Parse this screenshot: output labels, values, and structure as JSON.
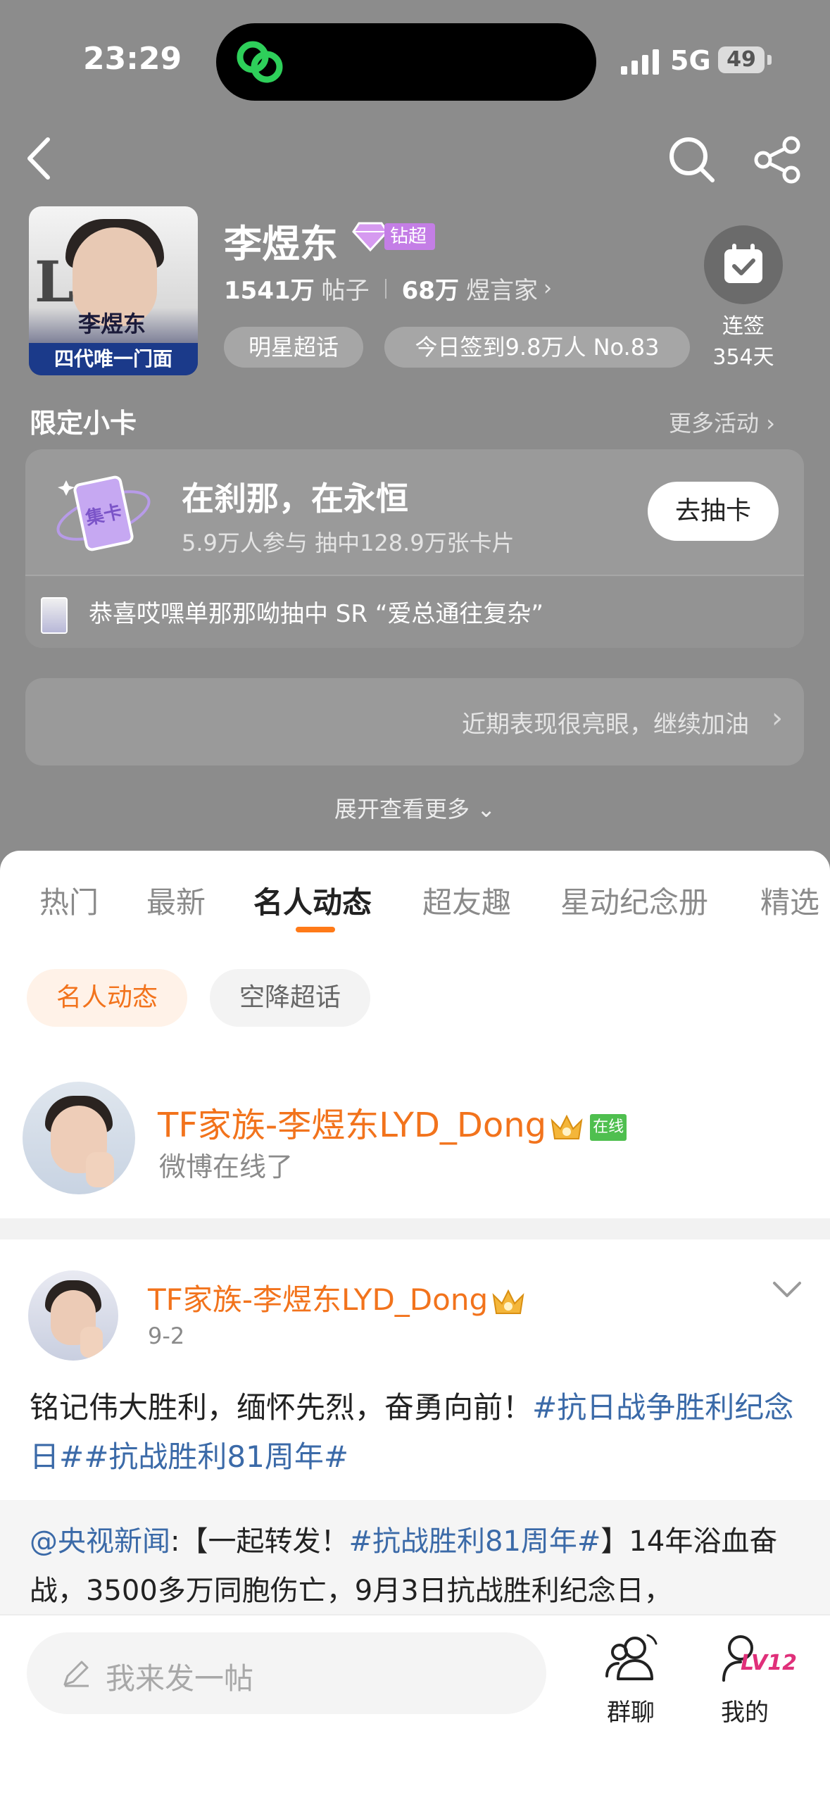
{
  "status_bar": {
    "time": "23:29",
    "network": "5G",
    "battery": "49"
  },
  "topic": {
    "title": "李煜东",
    "badge_label": "钻超",
    "posts_count": "1541万",
    "posts_unit": "帖子",
    "fans_count": "68万",
    "fans_unit": "煜言家",
    "chip_star": "明星超话",
    "chip_checkin": "今日签到9.8万人 No.83",
    "checkin_label": "连签",
    "checkin_days": "354天",
    "avatar_name_text": "李煜东",
    "avatar_caption": "四代唯一门面"
  },
  "limited_cards": {
    "section_title": "限定小卡",
    "more_label": "更多活动",
    "card_title": "在刹那，在永恒",
    "card_sub": "5.9万人参与 抽中128.9万张卡片",
    "draw_button": "去抽卡",
    "card_icon_text": "集卡",
    "footer_text": "恭喜哎嘿单那那呦抽中 SR “爱总通往复杂”"
  },
  "progress": {
    "text": "近期表现很亮眼，继续加油"
  },
  "expand_label": "展开查看更多",
  "tabs": [
    {
      "label": "热门"
    },
    {
      "label": "最新"
    },
    {
      "label": "名人动态"
    },
    {
      "label": "超友趣"
    },
    {
      "label": "星动纪念册"
    },
    {
      "label": "精选"
    }
  ],
  "sub_filters": [
    {
      "label": "名人动态"
    },
    {
      "label": "空降超话"
    }
  ],
  "live_row": {
    "name": "TF家族-李煜东LYD_Dong",
    "online_badge": "在线",
    "status": "微博在线了"
  },
  "post": {
    "author": "TF家族-李煜东LYD_Dong",
    "date": "9-2",
    "text_plain": "铭记伟大胜利，缅怀先烈，奋勇向前！",
    "hashtag1": "#抗日战争胜利纪念日#",
    "hashtag2": "#抗战胜利81周年#",
    "repost_mention": "@央视新闻",
    "repost_prefix": ":【一起转发！",
    "repost_hashtag": "#抗战胜利81周年#",
    "repost_rest": "】14年浴血奋战，3500多万同胞伤亡，9月3日抗战胜利纪念日，"
  },
  "bottom_bar": {
    "compose_placeholder": "我来发一帖",
    "group_chat": "群聊",
    "mine": "我的",
    "level": "LV12"
  },
  "colors": {
    "accent": "#f2731c",
    "link": "#3b6aa8",
    "header_bg": "#8c8c8c",
    "badge_purple": "#c47ee6"
  },
  "icons": [
    "back-icon",
    "search-icon",
    "share-icon",
    "diamond-icon",
    "calendar-check-icon",
    "card-collect-icon",
    "crown-icon",
    "pen-icon",
    "group-chat-icon",
    "profile-icon",
    "chevron-down-icon"
  ]
}
